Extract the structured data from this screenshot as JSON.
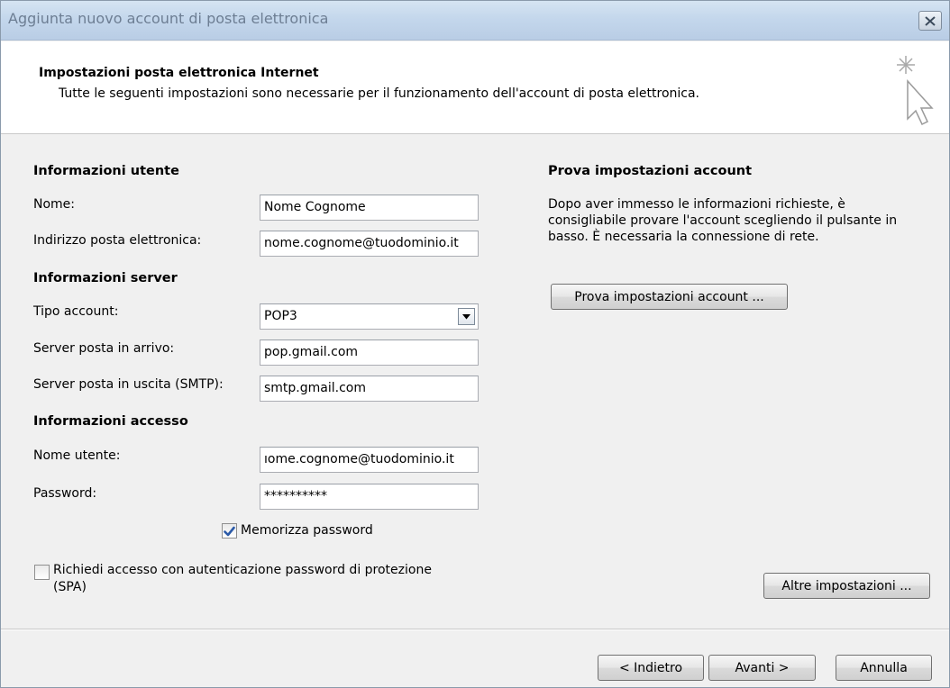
{
  "window": {
    "title": "Aggiunta nuovo account di posta elettronica",
    "close_icon": "close-icon"
  },
  "header": {
    "title": "Impostazioni posta elettronica Internet",
    "subtitle": "Tutte le seguenti impostazioni sono necessarie per il funzionamento dell'account di posta elettronica.",
    "icon": "cursor-sparkle-icon"
  },
  "user_info": {
    "section_title": "Informazioni utente",
    "name_label": "Nome:",
    "name_value": "Nome Cognome",
    "email_label": "Indirizzo posta elettronica:",
    "email_value": "nome.cognome@tuodominio.it"
  },
  "server_info": {
    "section_title": "Informazioni server",
    "account_type_label": "Tipo account:",
    "account_type_value": "POP3",
    "incoming_label": "Server posta in arrivo:",
    "incoming_value": "pop.gmail.com",
    "outgoing_label": "Server posta in uscita (SMTP):",
    "outgoing_value": "smtp.gmail.com"
  },
  "logon_info": {
    "section_title": "Informazioni accesso",
    "username_label": "Nome utente:",
    "username_value": "ıome.cognome@tuodominio.it",
    "password_label": "Password:",
    "password_value": "**********",
    "remember_label": "Memorizza password",
    "remember_checked": true,
    "spa_label_line1": "Richiedi accesso con autenticazione password di protezione",
    "spa_label_line2": "(SPA)",
    "spa_checked": false
  },
  "test_settings": {
    "section_title": "Prova impostazioni account",
    "description_line1": "Dopo aver immesso le informazioni richieste, è",
    "description_line2": "consigliabile provare l'account scegliendo il pulsante in",
    "description_line3": "basso. È necessaria la connessione di rete.",
    "test_button": "Prova impostazioni account ...",
    "more_settings_button": "Altre impostazioni ..."
  },
  "footer": {
    "back_button": "< Indietro",
    "next_button": "Avanti >",
    "cancel_button": "Annulla"
  }
}
